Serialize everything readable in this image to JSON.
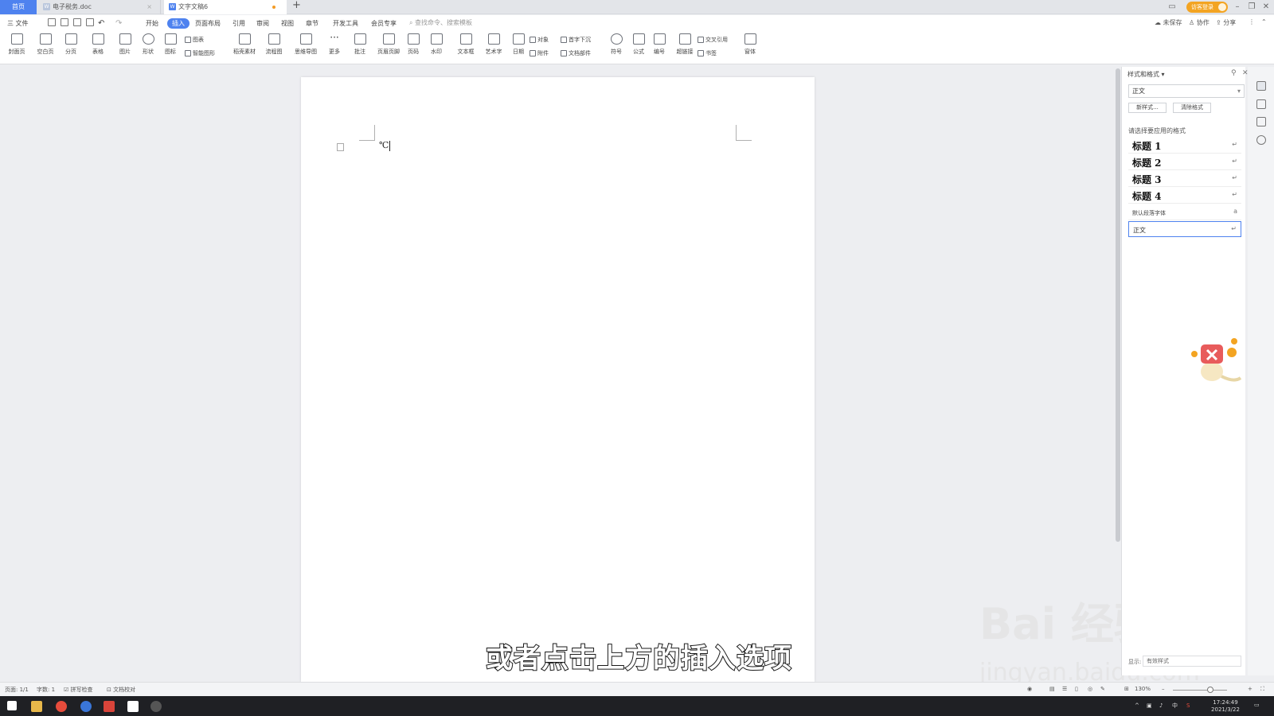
{
  "tabs": {
    "home": "首页",
    "doc1": "电子税务.doc",
    "doc2": "文字文稿6",
    "login": "访客登录"
  },
  "menu": {
    "file": "三 文件",
    "items": [
      "开始",
      "插入",
      "页面布局",
      "引用",
      "审阅",
      "视图",
      "章节",
      "开发工具",
      "会员专享"
    ],
    "active": "插入",
    "search_placeholder": "查找命令、搜索模板",
    "unsaved": "未保存",
    "collab": "协作",
    "share": "分享"
  },
  "ribbon": {
    "big": [
      "封面页",
      "空白页",
      "分页",
      "表格",
      "图片",
      "形状",
      "图标",
      "稻壳素材",
      "流程图",
      "思维导图",
      "更多",
      "批注",
      "页眉页脚",
      "页码",
      "水印",
      "文本框",
      "艺术字",
      "日期"
    ],
    "big2": [
      "符号",
      "公式",
      "编号",
      "超链接",
      "窗体"
    ],
    "small": {
      "chart": "图表",
      "smart": "智能图形",
      "object": "对象",
      "dropcap": "首字下沉",
      "attach": "附件",
      "docpart": "文档部件",
      "crossref": "交叉引用",
      "bookmark": "书签"
    }
  },
  "document": {
    "text": "℃"
  },
  "pane": {
    "title": "样式和格式 ▾",
    "current_style": "正文",
    "new_style": "新样式...",
    "clear_format": "清除格式",
    "hint": "请选择要应用的格式",
    "styles": [
      "标题 1",
      "标题 2",
      "标题 3",
      "标题 4"
    ],
    "default_font": "默认段落字体",
    "body": "正文",
    "show_label": "显示:",
    "show_value": "有效样式"
  },
  "status": {
    "page": "页面: 1/1",
    "words": "字数: 1",
    "spell": "拼写检查",
    "proof": "文档校对",
    "zoom": "130%"
  },
  "subtitle": "或者点击上方的插入选项",
  "watermark": {
    "brand": "Bai 经验",
    "url": "jingyan.baidu.com"
  },
  "clock": {
    "time": "17:24:49",
    "date": "2021/3/22"
  }
}
